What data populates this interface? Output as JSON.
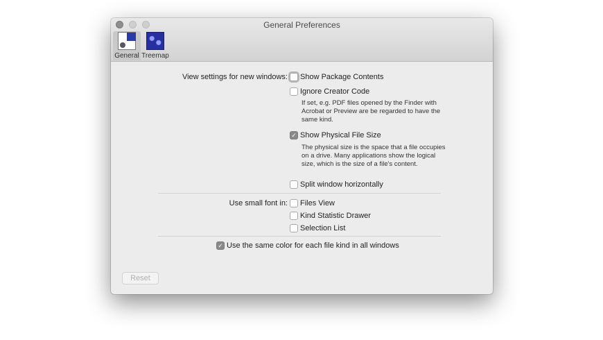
{
  "window": {
    "title": "General Preferences"
  },
  "tabs": [
    {
      "label": "General",
      "icon": "general-prefs-icon",
      "selected": true
    },
    {
      "label": "Treemap",
      "icon": "treemap-icon",
      "selected": false
    }
  ],
  "view_settings": {
    "label": "View settings for new windows:",
    "show_package": {
      "label": "Show Package Contents",
      "checked": false
    },
    "ignore_creator": {
      "label": "Ignore Creator Code",
      "checked": false,
      "help": "If set, e.g. PDF files opened by the Finder with Acrobat or Preview are be regarded to have the same kind."
    },
    "physical_size": {
      "label": "Show Physical File Size",
      "checked": true,
      "help": "The physical size is the space that a file occupies on a drive. Many applications show the logical size, which is the size of a file's content."
    },
    "split": {
      "label": "Split window horizontally",
      "checked": false
    }
  },
  "small_font": {
    "label": "Use small font in:",
    "files_view": {
      "label": "Files View",
      "checked": false
    },
    "kind_drawer": {
      "label": "Kind Statistic Drawer",
      "checked": false
    },
    "selection_list": {
      "label": "Selection List",
      "checked": false
    }
  },
  "same_color": {
    "label": "Use the same color for each file kind in all windows",
    "checked": true
  },
  "reset_label": "Reset"
}
